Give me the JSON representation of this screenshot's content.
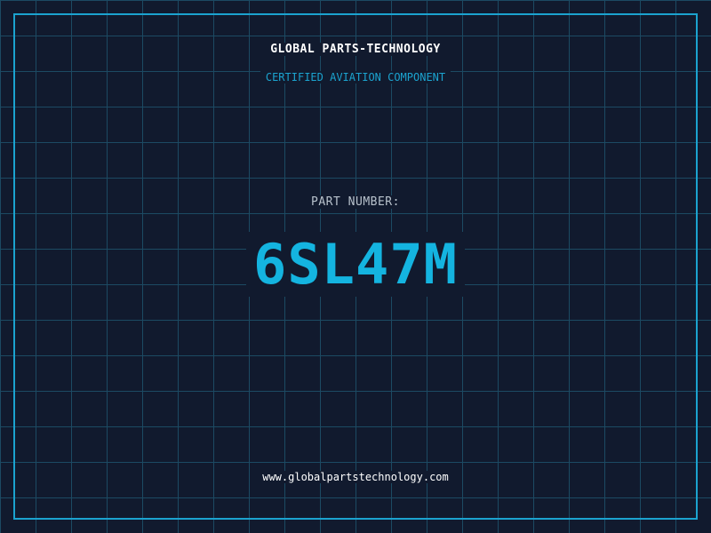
{
  "header": {
    "company": "GLOBAL PARTS-TECHNOLOGY",
    "tagline": "CERTIFIED AVIATION COMPONENT"
  },
  "part": {
    "label": "PART NUMBER:",
    "number": "6SL47M"
  },
  "footer": {
    "website": "www.globalpartstechnology.com"
  },
  "colors": {
    "background": "#111a2e",
    "grid": "#1c4a63",
    "accent": "#14b4e0",
    "frame": "#1ba3cf"
  }
}
